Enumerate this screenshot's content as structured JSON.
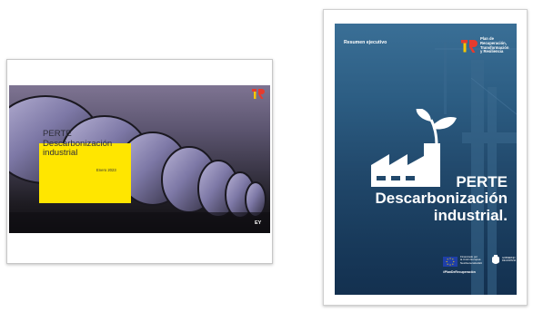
{
  "slide": {
    "title_line1": "PERTE",
    "title_line2": "Descarbonización",
    "title_line3": "industrial",
    "date": "Enero 2023",
    "brand_mark": "EY"
  },
  "cover": {
    "label": "Resumen ejecutivo",
    "plan_lines": [
      "Plan de",
      "Recuperación,",
      "Transformación",
      "y Resiliencia"
    ],
    "title_line1": "PERTE",
    "title_line2": "Descarbonización",
    "title_line3": "industrial.",
    "eu_lines": [
      "Financiado por",
      "la Unión Europea",
      "NextGenerationEU"
    ],
    "gov_lines": [
      "GOBIERNO",
      "DE ESPAÑA"
    ],
    "hashtag": "#PlanDeRecuperación"
  },
  "colors": {
    "slide_accent": "#ffe600",
    "cover_bg": "#21486b",
    "text_on_dark": "#ffffff"
  },
  "icons": [
    "plan-recuperacion-logo-icon",
    "factory-sprout-icon",
    "eu-flag-icon",
    "government-emblem-icon"
  ]
}
